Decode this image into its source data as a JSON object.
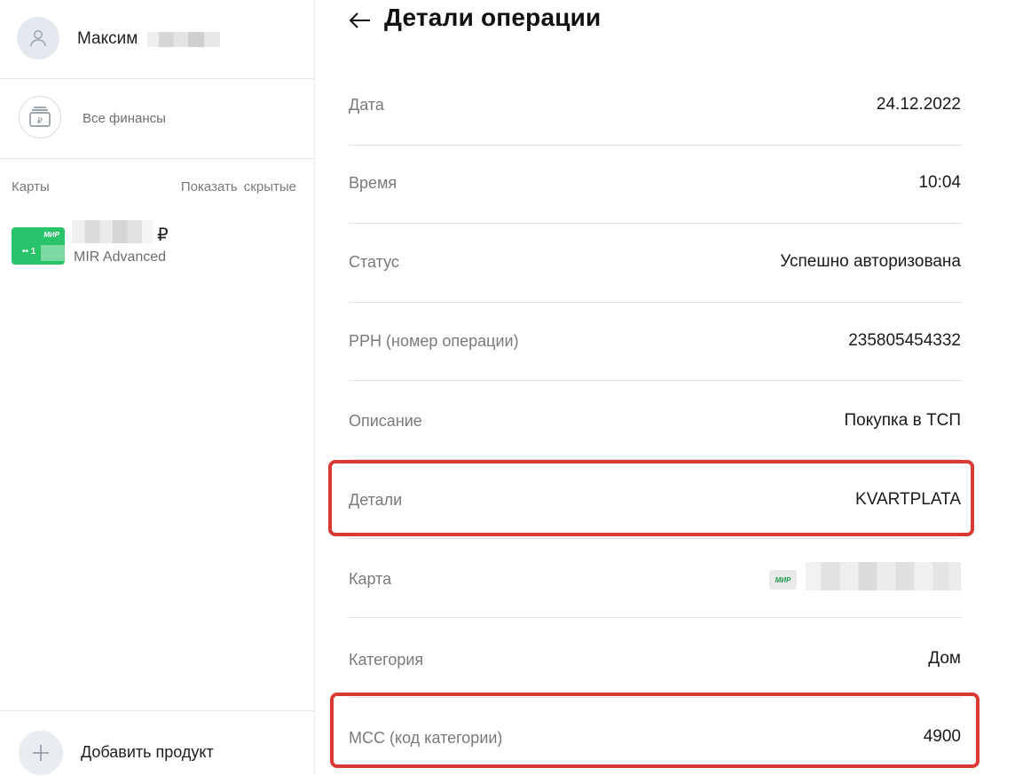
{
  "sidebar": {
    "user_name": "Максим",
    "all_finances": "Все финансы",
    "cards_header": "Карты",
    "show_hidden": "Показать скрытые",
    "card": {
      "currency": "₽",
      "brand_mark": "МИР",
      "number_prefix": "•• 1",
      "name": "MIR Advanced"
    },
    "add_product": "Добавить продукт"
  },
  "main": {
    "title": "Детали операции",
    "rows": [
      {
        "label": "Дата",
        "value": "24.12.2022"
      },
      {
        "label": "Время",
        "value": "10:04"
      },
      {
        "label": "Статус",
        "value": "Успешно авторизована"
      },
      {
        "label": "РРН (номер операции)",
        "value": "235805454332"
      },
      {
        "label": "Описание",
        "value": "Покупка в ТСП"
      },
      {
        "label": "Детали",
        "value": "KVARTPLATA"
      },
      {
        "label": "Карта",
        "value": "",
        "brand_mark": "МИР"
      },
      {
        "label": "Категория",
        "value": "Дом"
      },
      {
        "label": "МСС (код категории)",
        "value": "4900"
      }
    ]
  },
  "colors": {
    "highlight": "#d93a33",
    "card_green": "#29c46a",
    "label_gray": "#7a7a7a"
  },
  "icons": [
    "user-icon",
    "wallet-ruble-icon",
    "plus-icon",
    "arrow-left-icon"
  ]
}
